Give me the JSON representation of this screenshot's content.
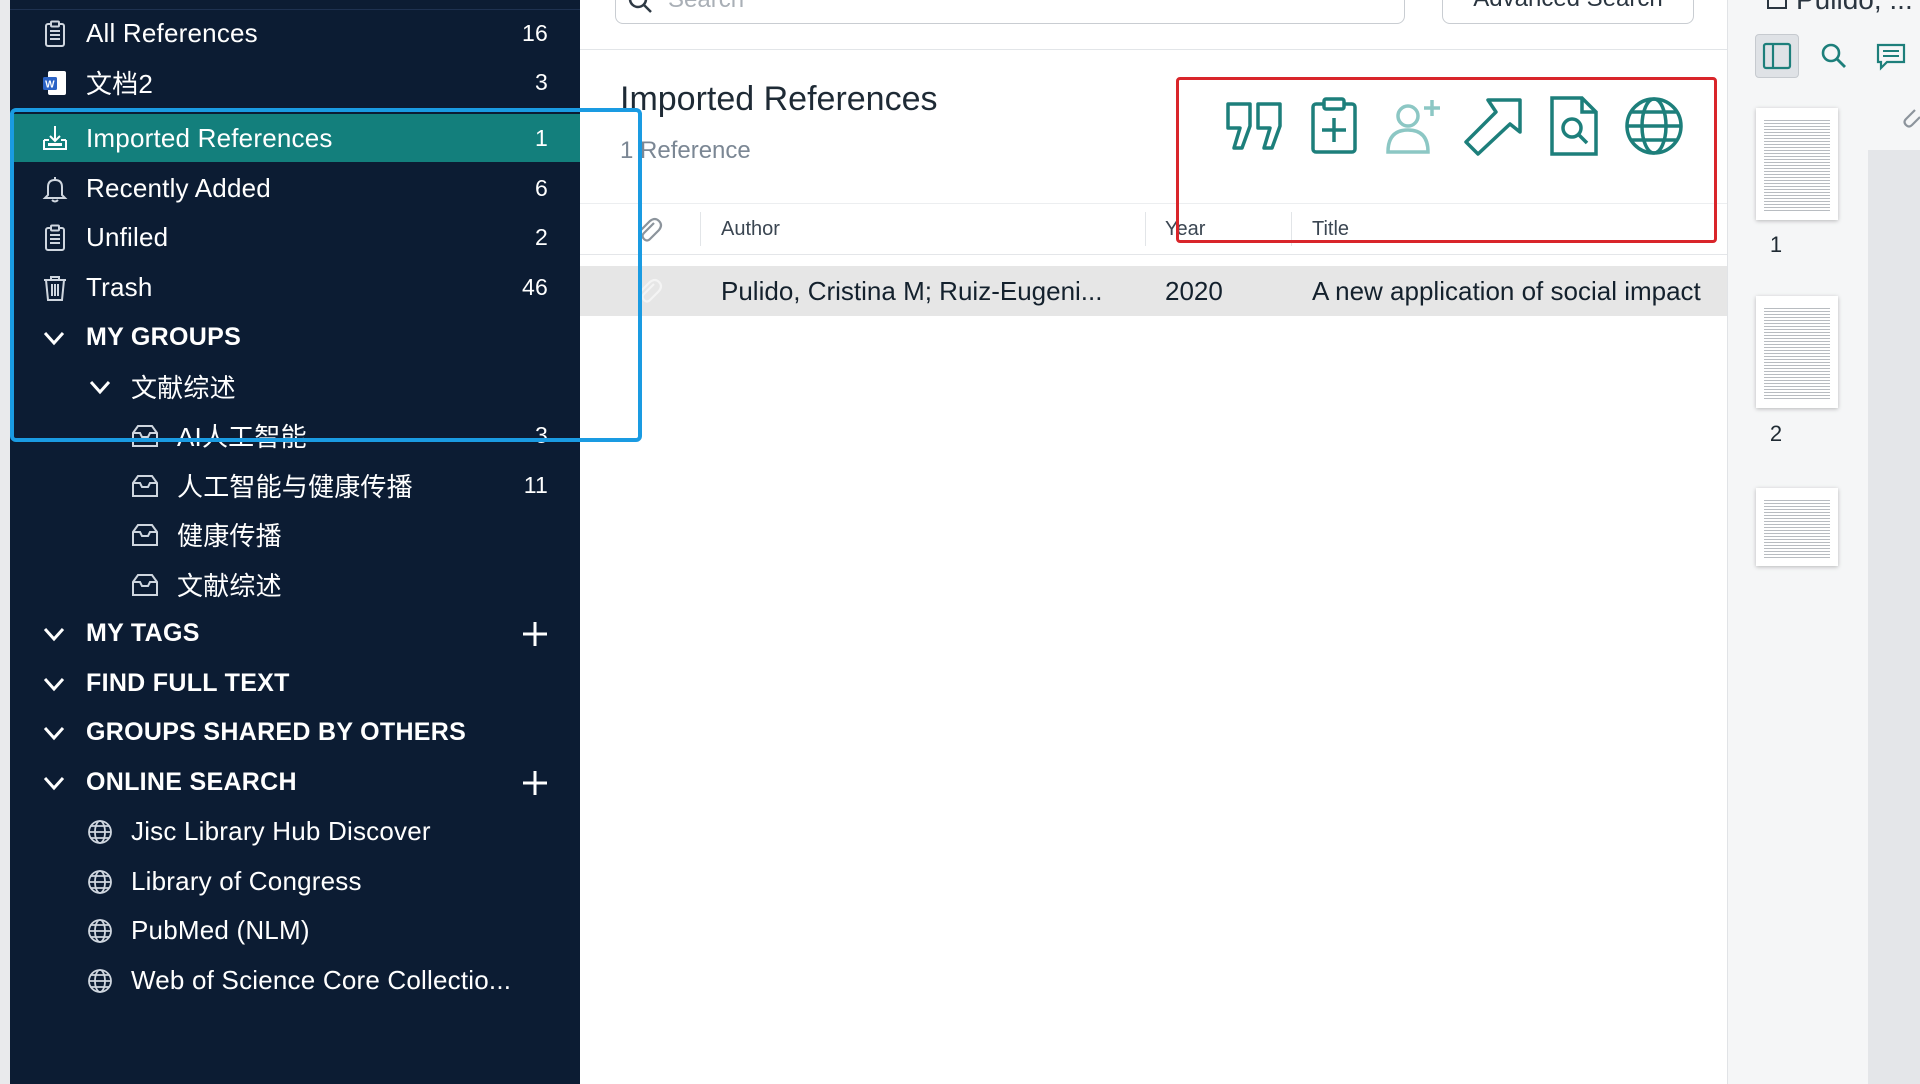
{
  "sidebar": {
    "items": [
      {
        "label": "All References",
        "count": "16",
        "icon": "clipboard-icon"
      },
      {
        "label": "文档2",
        "count": "3",
        "icon": "word-document-icon"
      },
      {
        "label": "Imported References",
        "count": "1",
        "icon": "import-icon",
        "selected": true
      },
      {
        "label": "Recently Added",
        "count": "6",
        "icon": "bell-icon"
      },
      {
        "label": "Unfiled",
        "count": "2",
        "icon": "clipboard-icon"
      },
      {
        "label": "Trash",
        "count": "46",
        "icon": "trash-icon"
      }
    ],
    "my_groups": {
      "header": "MY GROUPS",
      "group_set": "文献综述",
      "groups": [
        {
          "label": "AI人工智能",
          "count": "3"
        },
        {
          "label": "人工智能与健康传播",
          "count": "11"
        },
        {
          "label": "健康传播",
          "count": ""
        },
        {
          "label": "文献综述",
          "count": ""
        }
      ]
    },
    "sections": {
      "my_tags": "MY TAGS",
      "find_full_text": "FIND FULL TEXT",
      "groups_shared": "GROUPS SHARED BY OTHERS",
      "online_search": "ONLINE SEARCH"
    },
    "online_sources": [
      "Jisc Library Hub Discover",
      "Library of Congress",
      "PubMed (NLM)",
      "Web of Science Core Collectio..."
    ]
  },
  "main": {
    "search_placeholder": "Search",
    "advanced_search": "Advanced Search",
    "title": "Imported References",
    "subtitle": "1 Reference",
    "toolbar_icons": [
      "quote-icon",
      "clipboard-add-icon",
      "add-person-icon",
      "share-arrow-icon",
      "find-pdf-icon",
      "globe-icon"
    ],
    "columns": [
      "Author",
      "Year",
      "Title"
    ],
    "rows": [
      {
        "author": "Pulido, Cristina M; Ruiz-Eugeni...",
        "year": "2020",
        "title": "A new application of social impact"
      }
    ]
  },
  "right_pane": {
    "title": "Pulido, ...",
    "thumbnails": [
      "1",
      "2",
      ""
    ]
  },
  "colors": {
    "sidebar_bg": "#0c1c33",
    "selected_bg": "#137f7c",
    "accent_teal": "#1d7f7b",
    "annotation_blue": "#1a9be2",
    "annotation_red": "#d9252a"
  }
}
